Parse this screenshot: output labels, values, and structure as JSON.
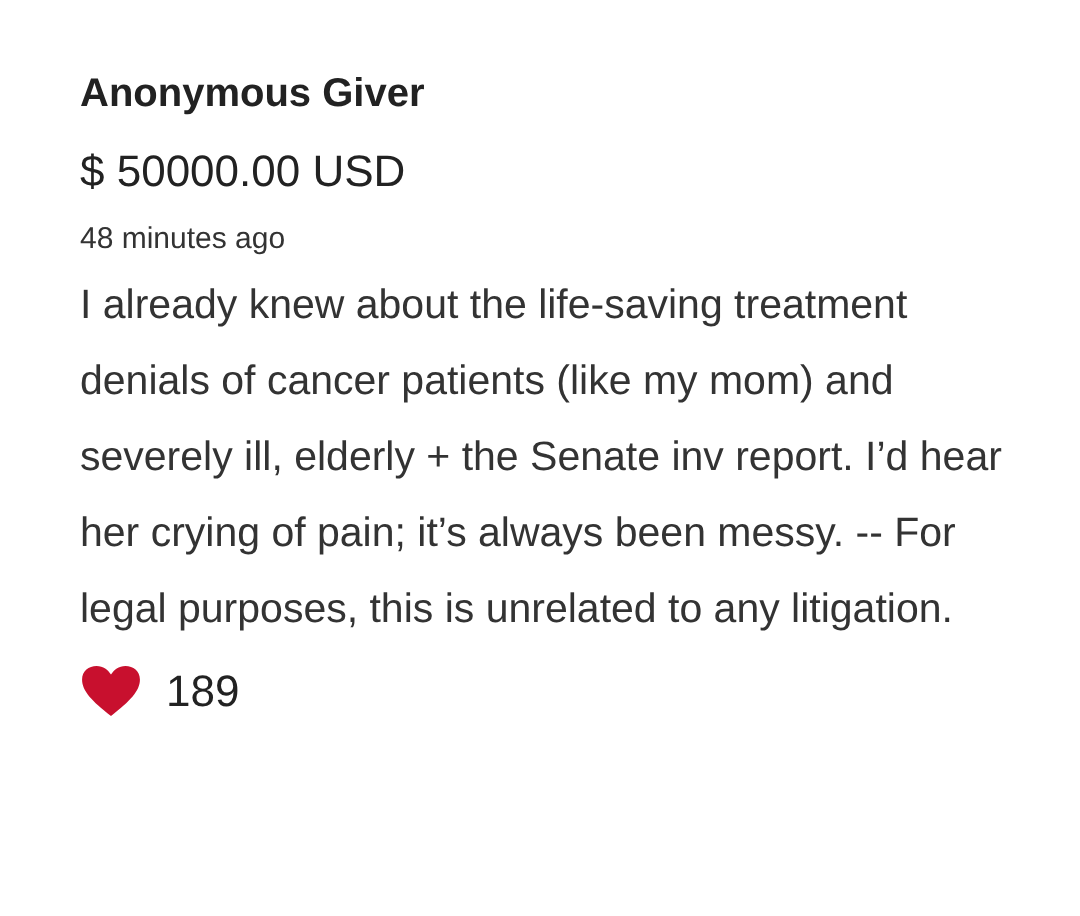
{
  "donation": {
    "donor": "Anonymous Giver",
    "amount": "$ 50000.00 USD",
    "time": "48 minutes ago",
    "message": "I already knew about the life-saving treatment denials of cancer patients (like my mom) and severely ill, elderly + the Senate inv report. I’d hear her crying of pain; it’s always been messy. -- For legal purposes, this is unrelated to any litigation.",
    "likes": "189"
  }
}
